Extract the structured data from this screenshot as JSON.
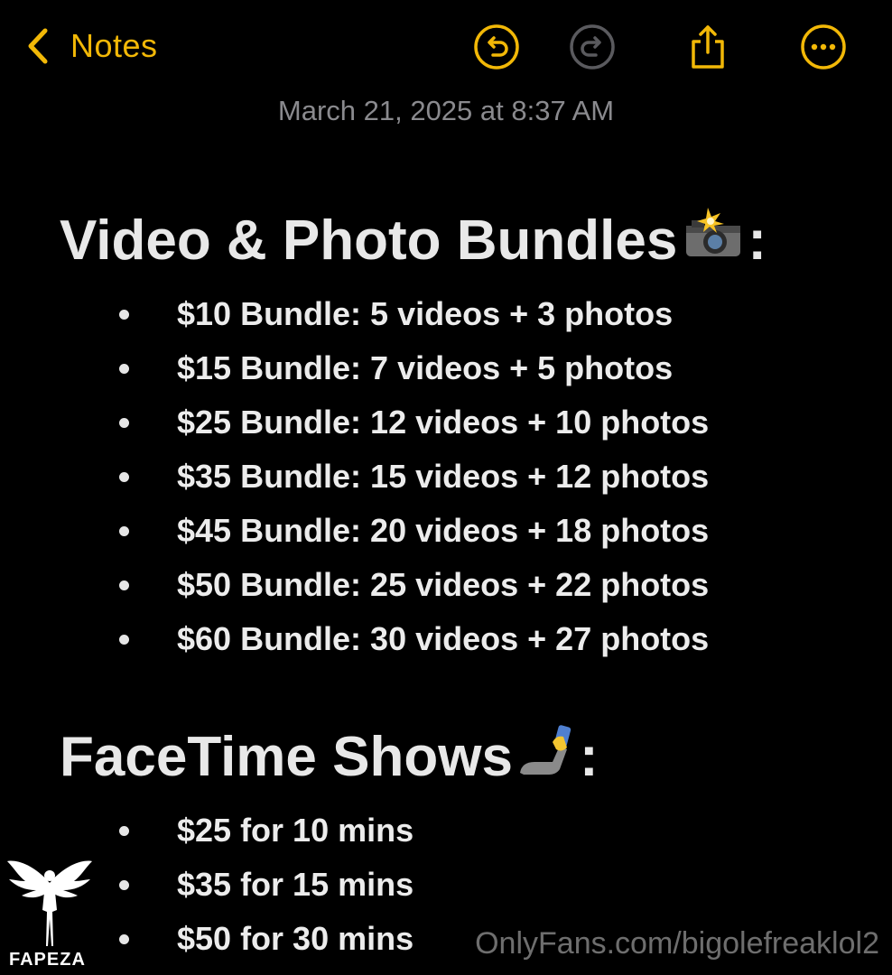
{
  "toolbar": {
    "back_label": "Notes",
    "accent": "#f2b807"
  },
  "note": {
    "timestamp": "March 21, 2025 at 8:37 AM",
    "section1": {
      "title": "Video & Photo Bundles",
      "emoji": "camera-with-flash-icon",
      "suffix": ":",
      "items": [
        "$10 Bundle: 5 videos + 3 photos",
        "$15 Bundle: 7 videos + 5 photos",
        "$25 Bundle: 12 videos + 10 photos",
        "$35 Bundle: 15 videos + 12 photos",
        "$45 Bundle: 20 videos + 18 photos",
        "$50 Bundle: 25 videos + 22 photos",
        "$60 Bundle: 30 videos + 27 photos"
      ]
    },
    "section2": {
      "title": "FaceTime Shows",
      "emoji": "selfie-icon",
      "suffix": ":",
      "items": [
        "$25 for 10 mins",
        "$35 for 15 mins",
        "$50 for 30 mins"
      ]
    }
  },
  "overlay": {
    "logo_text": "FAPEZA",
    "watermark": "OnlyFans.com/bigolefreaklol2"
  }
}
